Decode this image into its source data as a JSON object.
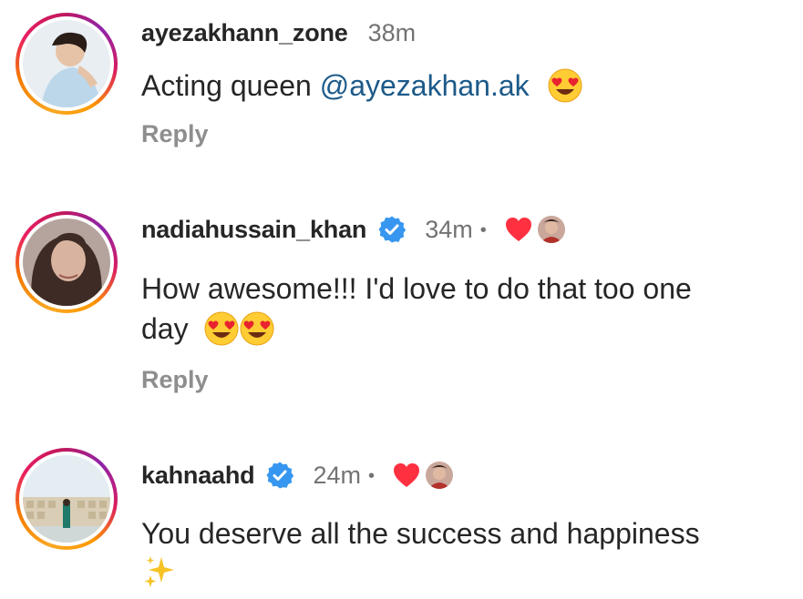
{
  "comments": [
    {
      "username": "ayezakhann_zone",
      "time": "38m",
      "text": "Acting queen ",
      "mention": "@ayezakhan.ak",
      "emoji": "heart-eyes",
      "reply_label": "Reply"
    },
    {
      "username": "nadiahussain_khan",
      "verified": true,
      "time": "34m",
      "separator": "•",
      "liked_by_author": true,
      "text_line1": "How awesome!!! I'd love to do that too one",
      "text_line2": "day",
      "emoji": [
        "heart-eyes",
        "heart-eyes"
      ],
      "reply_label": "Reply"
    },
    {
      "username": "kahnaahd",
      "verified": true,
      "time": "24m",
      "separator": "•",
      "liked_by_author": true,
      "text_line1": "You deserve all the success and happiness",
      "emoji": "sparkles"
    }
  ],
  "colors": {
    "text": "#262626",
    "muted": "#737373",
    "reply": "#8e8e8e",
    "mention": "#1c5a89",
    "verified": "#3797f0",
    "heart": "#ff3040"
  }
}
